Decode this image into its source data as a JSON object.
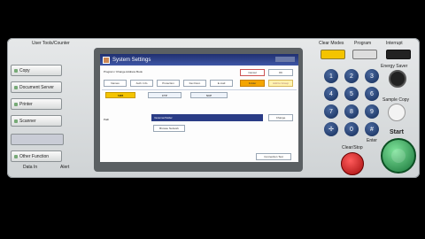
{
  "top_labels": {
    "user_tools": "User Tools/Counter",
    "clear_modes": "Clear Modes",
    "program": "Program",
    "interrupt": "Interrupt"
  },
  "left_panel": {
    "buttons": [
      "Copy",
      "Document Server",
      "Printer",
      "Scanner",
      "Other Function"
    ],
    "data_in": "Data In",
    "alert": "Alert"
  },
  "screen": {
    "title": "System Settings",
    "breadcrumb": "Program / Change Address Book",
    "cancel": "Cancel",
    "ok": "OK",
    "fields": [
      "Names",
      "Auth. Info",
      "Protection",
      "Fax Dest.",
      "E-mail",
      "Folder",
      "Add to Group"
    ],
    "tabs": [
      "SMB",
      "FTP",
      "NCP"
    ],
    "path_label": "Path",
    "path_value": "\\\\scanner\\folder",
    "change": "Change",
    "browse": "Browse Network",
    "connection_test": "Connection Test"
  },
  "right_panel": {
    "energy_saver": "Energy Saver",
    "sample_copy": "Sample Copy",
    "clear_stop": "Clear/Stop",
    "start": "Start",
    "enter": "Enter",
    "keypad": [
      "1",
      "2",
      "3",
      "4",
      "5",
      "6",
      "7",
      "8",
      "9",
      "✢",
      "0",
      "#"
    ]
  }
}
